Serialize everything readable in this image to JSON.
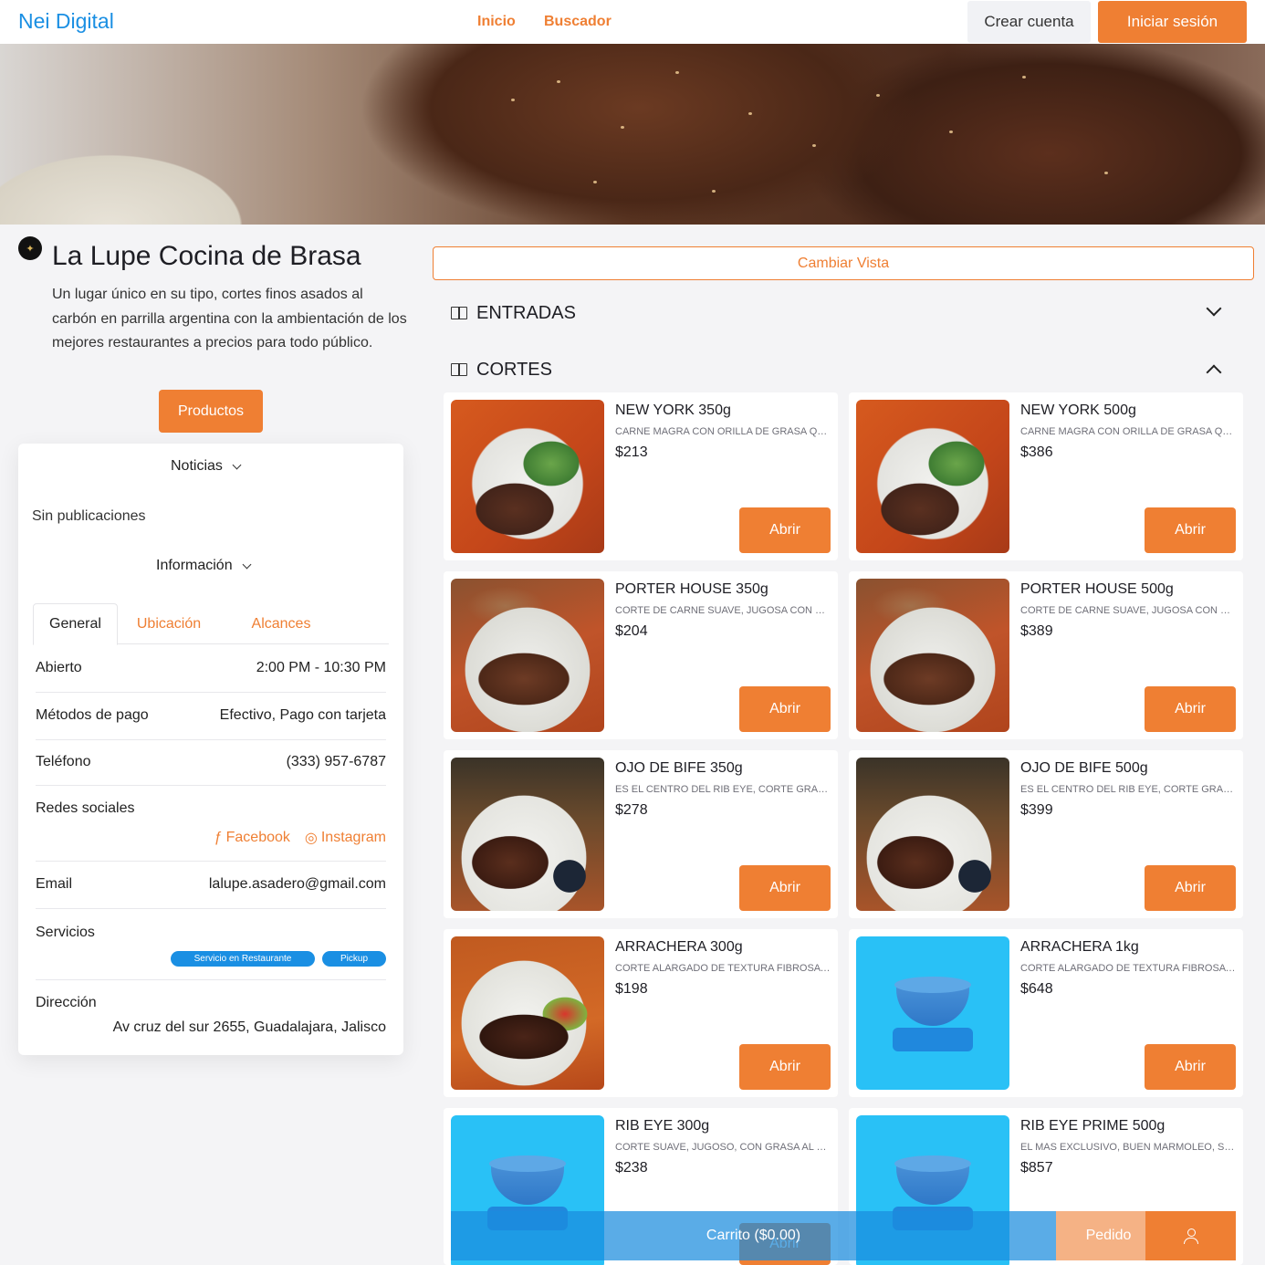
{
  "header": {
    "brand": "Nei Digital",
    "nav": [
      "Inicio",
      "Buscador"
    ],
    "create_account": "Crear cuenta",
    "login": "Iniciar sesión"
  },
  "restaurant": {
    "name": "La Lupe Cocina de Brasa",
    "description": "Un lugar único en su tipo, cortes finos asados al carbón en parrilla argentina con la ambientación de los mejores restaurantes a precios para todo público.",
    "products_button": "Productos"
  },
  "info_card": {
    "news_label": "Noticias",
    "no_posts": "Sin publicaciones",
    "info_label": "Información",
    "tabs": [
      "General",
      "Ubicación",
      "Alcances"
    ],
    "rows": {
      "open": {
        "label": "Abierto",
        "value": "2:00 PM - 10:30 PM"
      },
      "payment": {
        "label": "Métodos de pago",
        "value": "Efectivo, Pago con tarjeta"
      },
      "phone": {
        "label": "Teléfono",
        "value": "(333) 957-6787"
      },
      "social": {
        "label": "Redes sociales",
        "facebook": "Facebook",
        "instagram": "Instagram"
      },
      "email": {
        "label": "Email",
        "value": "lalupe.asadero@gmail.com"
      },
      "services": {
        "label": "Servicios",
        "items": [
          "Servicio en Restaurante",
          "Pickup"
        ]
      },
      "address": {
        "label": "Dirección",
        "value": "Av cruz del sur 2655, Guadalajara, Jalisco"
      }
    }
  },
  "menu": {
    "change_view": "Cambiar Vista",
    "sections": [
      "ENTRADAS",
      "CORTES"
    ],
    "open_label": "Abrir",
    "products": [
      {
        "name": "NEW YORK 350g",
        "desc": "CARNE MAGRA CON ORILLA DE GRASA QUE LE DA SABOR",
        "price": "$213",
        "image": "food"
      },
      {
        "name": "NEW YORK 500g",
        "desc": "CARNE MAGRA CON ORILLA DE GRASA QUE LE DA SABOR",
        "price": "$386",
        "image": "food"
      },
      {
        "name": "PORTER HOUSE 350g",
        "desc": "CORTE DE CARNE SUAVE, JUGOSA CON HUESO EN FORMA DE T",
        "price": "$204",
        "image": "food2"
      },
      {
        "name": "PORTER HOUSE 500g",
        "desc": "CORTE DE CARNE SUAVE, JUGOSA CON HUESO EN FORMA DE T",
        "price": "$389",
        "image": "food2"
      },
      {
        "name": "OJO DE BIFE 350g",
        "desc": "ES EL CENTRO DEL RIB EYE, CORTE GRASO Y JUGOSO",
        "price": "$278",
        "image": "food3"
      },
      {
        "name": "OJO DE BIFE 500g",
        "desc": "ES EL CENTRO DEL RIB EYE, CORTE GRASO Y JUGOSO",
        "price": "$399",
        "image": "food3"
      },
      {
        "name": "ARRACHERA 300g",
        "desc": "CORTE ALARGADO DE TEXTURA FIBROSA Y SABOR INTENSO",
        "price": "$198",
        "image": "food4"
      },
      {
        "name": "ARRACHERA 1kg",
        "desc": "CORTE ALARGADO DE TEXTURA FIBROSA Y SABOR INTENSO",
        "price": "$648",
        "image": "bowl"
      },
      {
        "name": "RIB EYE 300g",
        "desc": "CORTE SUAVE, JUGOSO, CON GRASA AL CENTRO",
        "price": "$238",
        "image": "bowl"
      },
      {
        "name": "RIB EYE PRIME 500g",
        "desc": "EL MAS EXCLUSIVO, BUEN MARMOLEO, SUAVE Y JUGOSO",
        "price": "$857",
        "image": "bowl"
      }
    ]
  },
  "bottom_bar": {
    "cart": "Carrito ($0.00)",
    "order": "Pedido"
  },
  "colors": {
    "accent": "#ef7f33",
    "brand_blue": "#1a8fe3",
    "background": "#f4f4f6"
  }
}
